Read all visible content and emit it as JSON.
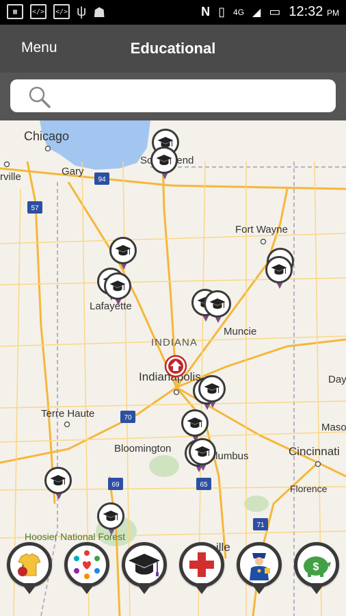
{
  "status_bar": {
    "time": "12:32",
    "ampm": "PM",
    "network": "4G",
    "left_icons": [
      "keyboard-icon",
      "code-icon",
      "code-icon",
      "usb-icon",
      "android-icon"
    ],
    "right_icons": [
      "nfc-icon",
      "vibrate-icon",
      "signal-icon",
      "battery-charging-icon"
    ]
  },
  "app_bar": {
    "menu_label": "Menu",
    "title": "Educational"
  },
  "search": {
    "placeholder": "",
    "value": ""
  },
  "map": {
    "cities": [
      {
        "name": "Chicago"
      },
      {
        "name": "Gary"
      },
      {
        "name": "rville"
      },
      {
        "name": "South Bend"
      },
      {
        "name": "Fort Wayne"
      },
      {
        "name": "Lafayette"
      },
      {
        "name": "Muncie"
      },
      {
        "name": "INDIANA"
      },
      {
        "name": "Indianapolis"
      },
      {
        "name": "Terre Haute"
      },
      {
        "name": "Bloomington"
      },
      {
        "name": "Columbus"
      },
      {
        "name": "Cincinnati"
      },
      {
        "name": "Florence"
      },
      {
        "name": "Hoosier National Forest"
      },
      {
        "name": "Day"
      },
      {
        "name": "Maso"
      },
      {
        "name": "ille"
      }
    ],
    "highway_shields": [
      "94",
      "57",
      "70",
      "69",
      "65",
      "71"
    ],
    "pin_icon": "graduation-cap-icon",
    "current_location_icon": "home-marker-icon"
  },
  "categories": [
    {
      "name": "food-clothing",
      "icon": "shirt-apple-icon"
    },
    {
      "name": "community",
      "icon": "people-heart-icon"
    },
    {
      "name": "educational",
      "icon": "graduation-cap-icon"
    },
    {
      "name": "medical",
      "icon": "red-cross-icon"
    },
    {
      "name": "public-safety",
      "icon": "police-officer-icon"
    },
    {
      "name": "financial",
      "icon": "piggy-bank-icon"
    }
  ],
  "colors": {
    "app_bar": "#4a4a4a",
    "search_bar_bg": "#555555",
    "pin_tail": "#7a4c8a",
    "lake": "#a3c6f0",
    "road": "#f5b73a"
  }
}
